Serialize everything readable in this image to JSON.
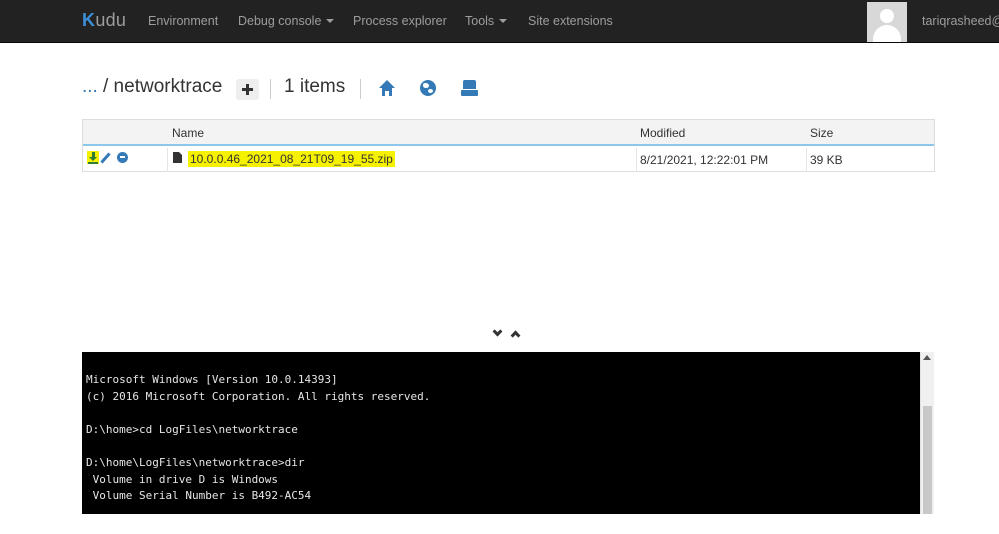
{
  "navbar": {
    "brand": "Kudu",
    "items": [
      {
        "label": "Environment",
        "dropdown": false
      },
      {
        "label": "Debug console",
        "dropdown": true
      },
      {
        "label": "Process explorer",
        "dropdown": false
      },
      {
        "label": "Tools",
        "dropdown": true
      },
      {
        "label": "Site extensions",
        "dropdown": false
      }
    ],
    "username": "tariqrasheed@"
  },
  "breadcrumb": {
    "ellipsis": "...",
    "current": "/ networktrace",
    "item_count": "1 items"
  },
  "toolbar_icons": [
    "home-icon",
    "globe-icon",
    "drive-icon"
  ],
  "file_table": {
    "headers": [
      "Name",
      "Modified",
      "Size"
    ],
    "rows": [
      {
        "name": "10.0.0.46_2021_08_21T09_19_55.zip",
        "modified": "8/21/2021, 12:22:01 PM",
        "size": "39 KB",
        "highlight": "#f5f100"
      }
    ]
  },
  "console": {
    "lines": "Microsoft Windows [Version 10.0.14393]\n(c) 2016 Microsoft Corporation. All rights reserved.\n\nD:\\home>cd LogFiles\\networktrace\n\nD:\\home\\LogFiles\\networktrace>dir\n Volume in drive D is Windows\n Volume Serial Number is B492-AC54"
  },
  "colors": {
    "navbar_bg": "#222222",
    "accent": "#337ab7",
    "highlight": "#f5f100",
    "console_bg": "#000000"
  }
}
